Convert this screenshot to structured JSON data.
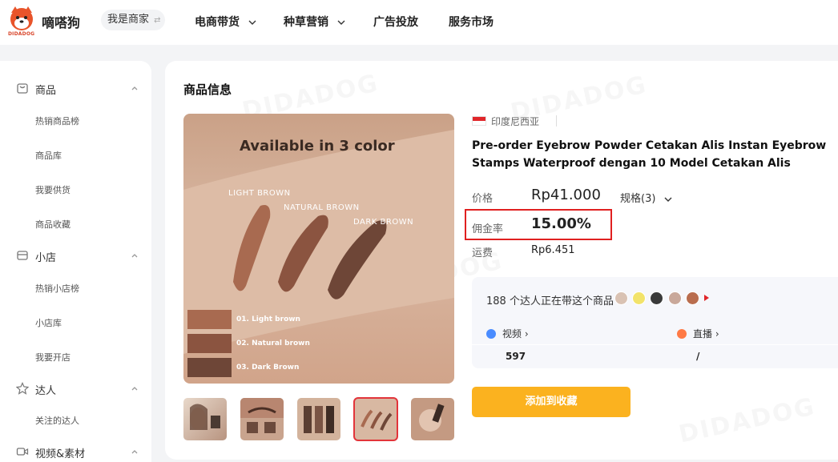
{
  "brand": {
    "name": "嘀嗒狗",
    "logo_sub": "DIDADOG",
    "color": "#e8542a",
    "watermark": "DIDADOG"
  },
  "header": {
    "merchant_btn": "我是商家",
    "nav": [
      "电商带货",
      "种草营销",
      "广告投放",
      "服务市场"
    ]
  },
  "sidebar": {
    "groups": [
      {
        "label": "商品",
        "icon": "product-icon",
        "items": [
          "热销商品榜",
          "商品库",
          "我要供货",
          "商品收藏"
        ]
      },
      {
        "label": "小店",
        "icon": "shop-icon",
        "items": [
          "热销小店榜",
          "小店库",
          "我要开店"
        ]
      },
      {
        "label": "达人",
        "icon": "star-icon",
        "items": [
          "关注的达人"
        ]
      },
      {
        "label": "视频&素材",
        "icon": "video-icon",
        "items": []
      }
    ]
  },
  "product": {
    "section_title": "商品信息",
    "region": "印度尼西亚",
    "title": "Pre-order Eyebrow Powder Cetakan Alis Instan Eyebrow Stamps Waterproof dengan 10 Model Cetakan Alis",
    "image": {
      "headline": "Available in 3 color",
      "shade_labels": [
        "LIGHT BROWN",
        "NATURAL BROWN",
        "DARK BROWN"
      ],
      "swatches": [
        "01. Light brown",
        "02. Natural brown",
        "03. Dark Brown"
      ],
      "swatch_colors": [
        "#a86a50",
        "#8b5440",
        "#6e4637"
      ]
    },
    "thumbnails_count": 5,
    "selected_thumbnail": 4,
    "price_label": "价格",
    "price": "Rp41.000",
    "spec": "规格(3)",
    "commission_label": "佣金率",
    "commission": "15.00%",
    "shipping_label": "运费",
    "shipping": "Rp6.451",
    "creators_text": "188 个达人正在带这个商品",
    "creator_avatar_colors": [
      "#d9c2b3",
      "#f2e36a",
      "#3a3a3a",
      "#c9a89a",
      "#b96d4e"
    ],
    "video_label": "视频",
    "video_value": "597",
    "live_label": "直播",
    "live_value": "/",
    "video_icon_color": "#4a8cff",
    "live_icon_color": "#ff7a45",
    "add_fav_btn": "添加到收藏",
    "accent_btn_color": "#fbb21f",
    "highlight_color": "#e02020"
  }
}
